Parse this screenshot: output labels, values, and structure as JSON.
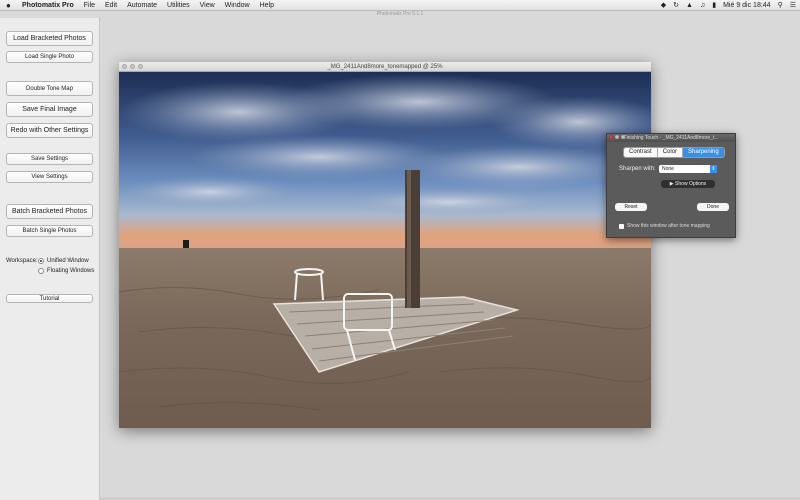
{
  "menubar": {
    "app_name": "Photomatix Pro",
    "items": [
      "File",
      "Edit",
      "Automate",
      "Utilities",
      "View",
      "Window",
      "Help"
    ],
    "status": {
      "datetime": "Mié 9 dic  18:44"
    }
  },
  "faint_title": "Photomatix Pro 5.1.1",
  "panel": {
    "buttons": {
      "load_bracketed": "Load Bracketed Photos",
      "load_single": "Load Single Photo",
      "double_tone_map": "Double Tone Map",
      "save_final": "Save Final Image",
      "redo_settings": "Redo with Other Settings",
      "save_settings": "Save Settings",
      "view_settings": "View Settings",
      "batch_bracketed": "Batch Bracketed Photos",
      "batch_single": "Batch Single Photos",
      "tutorial": "Tutorial"
    },
    "workspace": {
      "label": "Workspace:",
      "options": [
        "Unified Window",
        "Floating Windows"
      ],
      "selected": "Unified Window"
    }
  },
  "image_window": {
    "title": "_MG_2411And8more_tonemapped @ 25%"
  },
  "finishing_touch": {
    "title": "Finishing Touch - _MG_2411And8more_t...",
    "tabs": [
      "Contrast",
      "Color",
      "Sharpening"
    ],
    "active_tab": "Sharpening",
    "sharpen_label": "Sharpen with:",
    "sharpen_value": "None",
    "show_options": "Show Options",
    "reset": "Reset",
    "done": "Done",
    "checkbox_label": "Show this window after tone mapping"
  },
  "colors": {
    "accent": "#3a8ee6",
    "close_red": "#e0443e"
  }
}
